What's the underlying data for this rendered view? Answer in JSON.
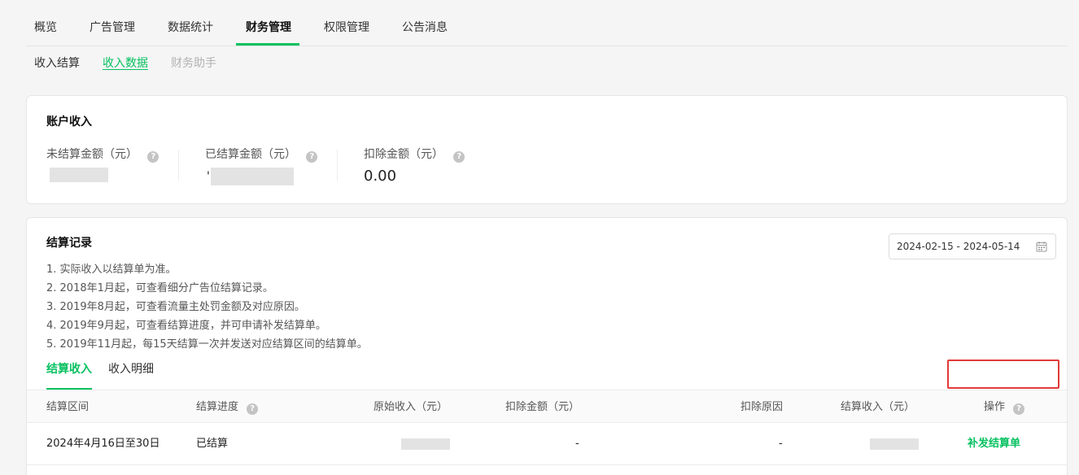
{
  "top_tabs": [
    {
      "label": "概览"
    },
    {
      "label": "广告管理"
    },
    {
      "label": "数据统计"
    },
    {
      "label": "财务管理"
    },
    {
      "label": "权限管理"
    },
    {
      "label": "公告消息"
    }
  ],
  "active_top_tab": "财务管理",
  "sub_tabs": [
    {
      "label": "收入结算"
    },
    {
      "label": "收入数据"
    },
    {
      "label": "财务助手"
    }
  ],
  "active_sub_tab": "收入数据",
  "account": {
    "title": "账户收入",
    "metrics": [
      {
        "label": "未结算金额（元）",
        "value": ""
      },
      {
        "label": "已结算金额（元）",
        "value": "'"
      },
      {
        "label": "扣除金额（元）",
        "value": "0.00"
      }
    ]
  },
  "records": {
    "title": "结算记录",
    "notes": [
      "1. 实际收入以结算单为准。",
      "2. 2018年1月起，可查看细分广告位结算记录。",
      "3. 2019年8月起，可查看流量主处罚金额及对应原因。",
      "4. 2019年9月起，可查看结算进度，并可申请补发结算单。",
      "5. 2019年11月起，每15天结算一次并发送对应结算区间的结算单。"
    ],
    "date_range": "2024-02-15 - 2024-05-14",
    "tabs": [
      {
        "label": "结算收入"
      },
      {
        "label": "收入明细"
      }
    ],
    "active_tab": "结算收入",
    "columns": [
      "结算区间",
      "结算进度",
      "原始收入（元）",
      "扣除金额（元）",
      "扣除原因",
      "结算收入（元）",
      "操作"
    ],
    "rows": [
      {
        "period": "2024年4月16日至30日",
        "status": "已结算",
        "original_income": "",
        "deduction": "-",
        "deduction_reason": "-",
        "settled_income": "",
        "action": "补发结算单"
      }
    ]
  },
  "colors": {
    "accent": "#07c160",
    "highlight_box": "#e33a3a"
  },
  "icons": {
    "help": "question-circle-icon",
    "calendar": "calendar-icon"
  }
}
